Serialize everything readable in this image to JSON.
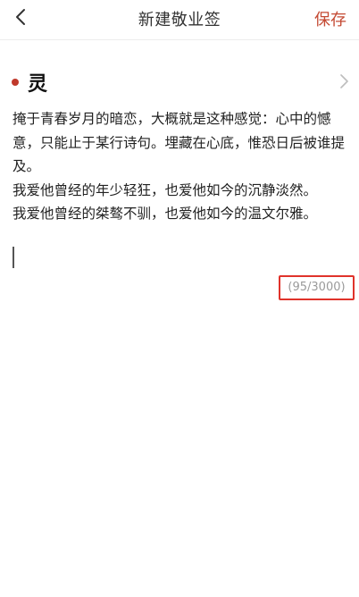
{
  "header": {
    "back_icon": "chevron-left-icon",
    "title": "新建敬业签",
    "save_label": "保存"
  },
  "note": {
    "heading": "灵",
    "accent_color": "#c0392b",
    "expand_icon": "chevron-right-icon",
    "lines": [
      "掩于青春岁月的暗恋，大概就是这种感觉：心中的憾意，只能止于某行诗句。埋藏在心底，惟恐日后被谁提及。",
      "我爱他曾经的年少轻狂，也爱他如今的沉静淡然。",
      "我爱他曾经的桀骜不驯，也爱他如今的温文尔雅。"
    ]
  },
  "counter": {
    "text": "(95/3000)",
    "highlight_color": "#e0332b"
  }
}
